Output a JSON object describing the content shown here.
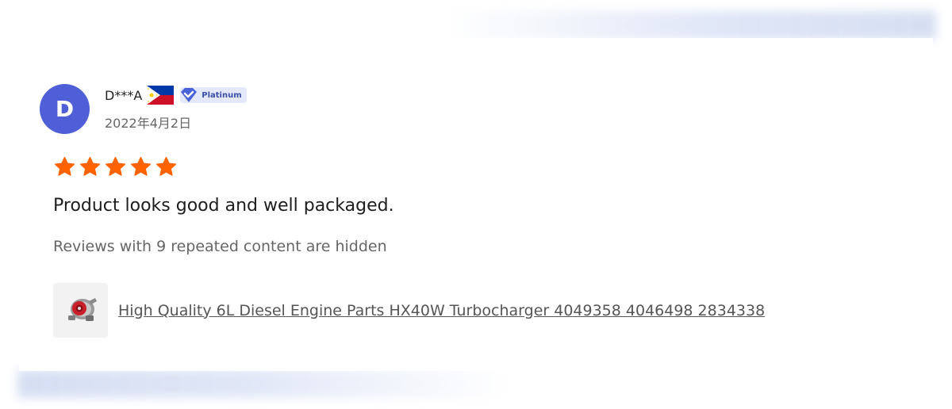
{
  "reviewer": {
    "avatar_letter": "D",
    "avatar_color": "#4e5fd7",
    "name": "D***A",
    "country_flag": "philippines-flag-icon",
    "badge": {
      "label": "Platinum",
      "icon": "diamond-heart-icon"
    },
    "date": "2022年4月2日"
  },
  "review": {
    "rating": 5,
    "max_rating": 5,
    "star_color": "#ff6200",
    "text": "Product looks good and well packaged.",
    "hidden_note": "Reviews with 9 repeated content are hidden"
  },
  "product": {
    "thumbnail": "turbocharger-image",
    "title": "High Quality 6L Diesel Engine Parts HX40W Turbocharger 4049358 4046498 2834338"
  }
}
